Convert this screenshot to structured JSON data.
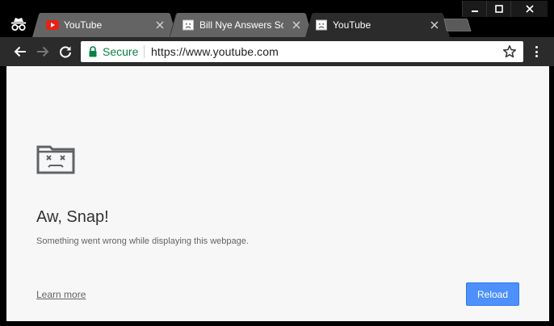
{
  "window": {
    "controls": [
      "minimize",
      "maximize",
      "close"
    ]
  },
  "tabs": [
    {
      "title": "YouTube",
      "favicon": "youtube-icon",
      "active": false
    },
    {
      "title": "Bill Nye Answers Sc",
      "favicon": "sad-page-icon",
      "active": false
    },
    {
      "title": "YouTube",
      "favicon": "sad-page-icon",
      "active": true
    }
  ],
  "toolbar": {
    "secure_label": "Secure",
    "url": "https://www.youtube.com"
  },
  "page": {
    "heading": "Aw, Snap!",
    "message": "Something went wrong while displaying this webpage.",
    "learn_more": "Learn more",
    "reload": "Reload"
  },
  "colors": {
    "secure_green": "#0b8043",
    "reload_blue": "#4d90fe",
    "page_bg": "#f7f7f7",
    "toolbar_bg": "#2b2b2b",
    "youtube_red": "#e62117"
  }
}
